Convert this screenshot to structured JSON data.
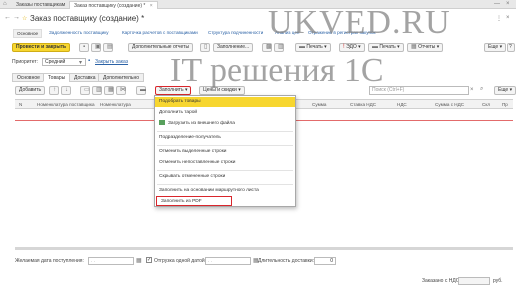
{
  "window_tabs": [
    "Заказы поставщикам",
    "Заказ поставщику (создание) *"
  ],
  "doc_title": "Заказ поставщику (создание) *",
  "watermark": {
    "line1": "UKVED.RU",
    "line2": "IT решения 1С"
  },
  "nav": {
    "main": "Основное",
    "links": [
      "Задолженность поставщику",
      "Карточка расчетов с поставщиками",
      "Структура подчиненности",
      "Анализ цен",
      "Отражение в регистрах закупок"
    ]
  },
  "toolbar": {
    "post_close": "Провести и закрыть",
    "additional_reports": "Дополнительные отчеты",
    "fill_on_basis": "Заполнение...",
    "print": "Печать",
    "edo": "ЭДО",
    "print2": "Печать",
    "reports": "Отчеты",
    "more": "Еще",
    "help": "?"
  },
  "priority": {
    "label": "Приоритет:",
    "value": "Средний"
  },
  "close_order_link": "Закрыть заказ",
  "form_tabs": [
    "Основное",
    "Товары",
    "Доставка",
    "Дополнительно"
  ],
  "items_toolbar": {
    "add": "Добавить",
    "fill": "Заполнить",
    "prices": "Цены и скидки",
    "search_placeholder": "Поиск (Ctrl+F)",
    "more": "Еще"
  },
  "table_headers": [
    "N",
    "Номенклатура поставщика",
    "Номенклатура",
    "Сумма",
    "Ставка НДС",
    "НДС",
    "Сумма с НДС",
    "Скл",
    "Пр"
  ],
  "fill_menu": [
    "Подобрать товары",
    "Дополнить тарой",
    "Загрузить из внешнего файла",
    "Подразделение-получатель",
    "Отменить выделенные строки",
    "Отменить непоставленные строки",
    "Скрывать отмененные строки",
    "Заполнить на основании маршрутного листа",
    "Заполнить из PDF"
  ],
  "footer": {
    "expected_date_label": "Желаемая дата поступления:",
    "single_date_label": "Отгрузка одной датой",
    "single_date_checked": true,
    "delivery_duration_label": "Длительность доставки:",
    "delivery_duration_value": "0",
    "total_label": "Заказано с НДС:",
    "total_currency": "руб."
  },
  "colors": {
    "accent_yellow": "#f7d62f",
    "link_blue": "#2b62a6",
    "highlight_red": "#d9262c"
  }
}
